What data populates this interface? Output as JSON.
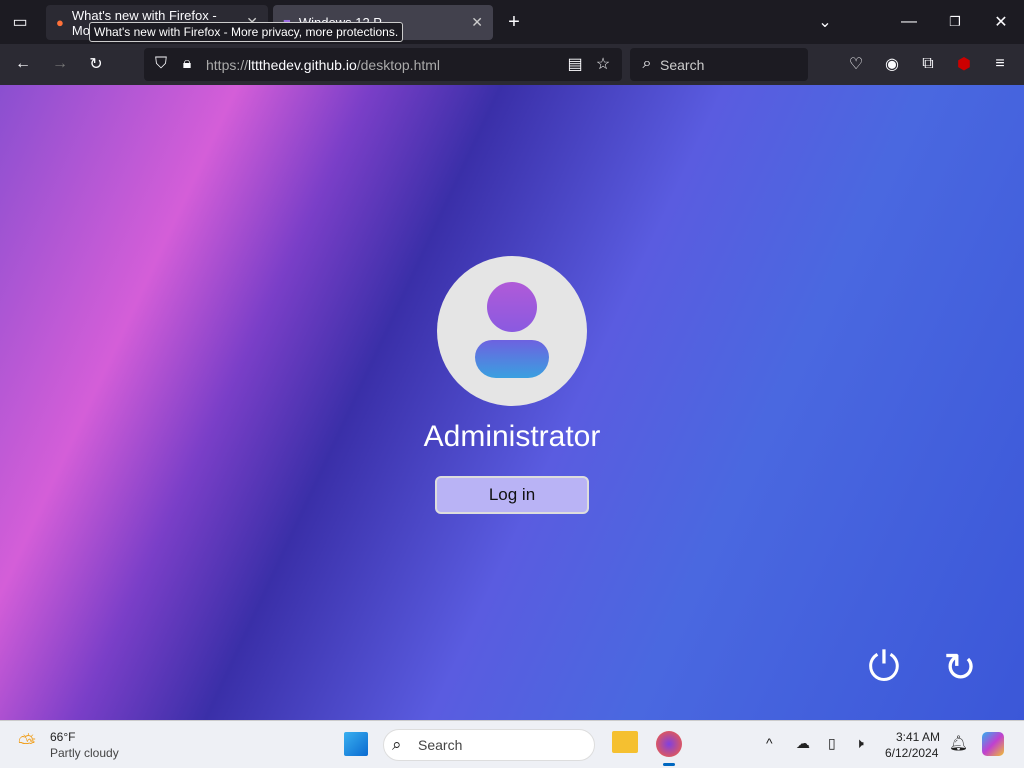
{
  "browser": {
    "tabs": [
      {
        "label": "What's new with Firefox - Mo",
        "close": "✕"
      },
      {
        "label": "Windows 12 P",
        "close": "✕"
      }
    ],
    "tooltip": "What's new with Firefox - More privacy, more protections.",
    "new_tab": "+",
    "url_prefix": "https://",
    "url_host": "lttthedev.github.io",
    "url_path": "/desktop.html",
    "search_placeholder": "Search"
  },
  "login": {
    "username": "Administrator",
    "button": "Log in"
  },
  "taskbar": {
    "weather_temp": "66°F",
    "weather_desc": "Partly cloudy",
    "search_placeholder": "Search",
    "time": "3:41 AM",
    "date": "6/12/2024"
  }
}
